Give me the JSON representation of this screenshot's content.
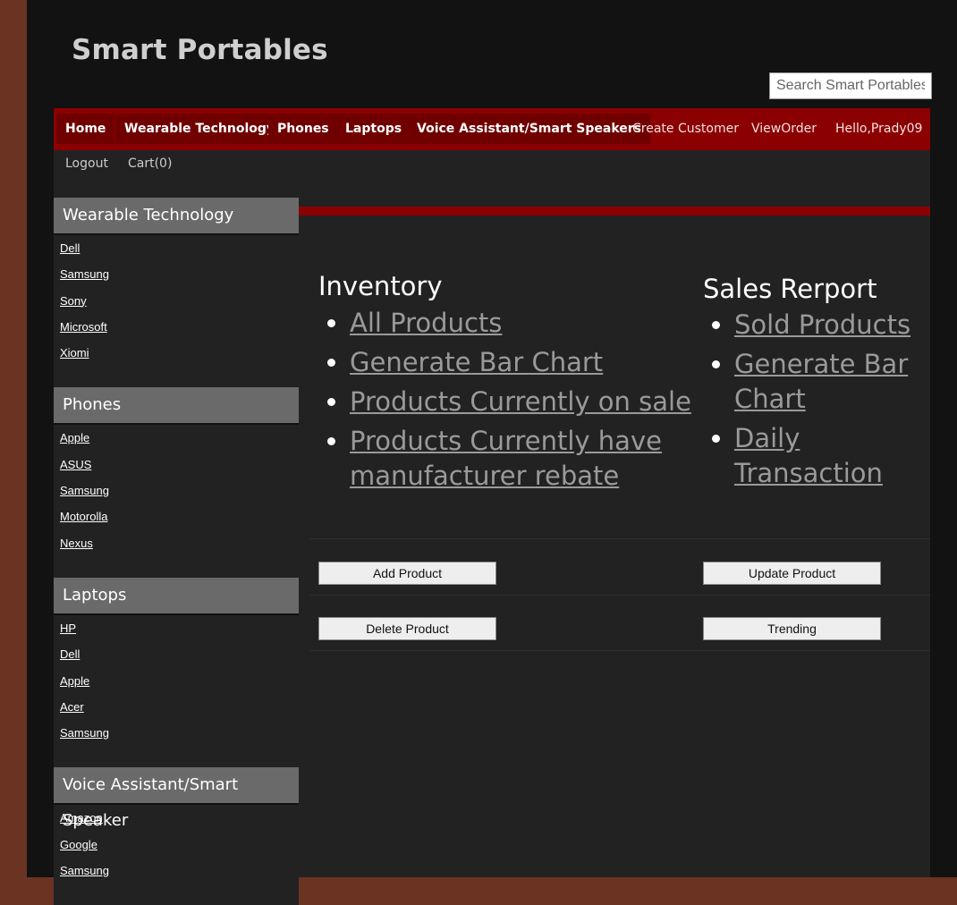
{
  "site": {
    "title": "Smart Portables"
  },
  "search": {
    "placeholder": "Search Smart Portables"
  },
  "nav": {
    "items": [
      "Home",
      "Wearable Technology",
      "Phones",
      "Laptops",
      "Voice Assistant/Smart Speakers"
    ],
    "links": [
      "Create Customer",
      "ViewOrder",
      "Hello,Prady09"
    ],
    "sub": [
      "Logout",
      "Cart(0)"
    ]
  },
  "sidebar": {
    "sections": [
      {
        "title": "Wearable Technology",
        "items": [
          "Dell",
          "Samsung",
          "Sony",
          "Microsoft",
          "Xiomi"
        ]
      },
      {
        "title": "Phones",
        "items": [
          "Apple",
          "ASUS",
          "Samsung",
          "Motorolla",
          "Nexus"
        ]
      },
      {
        "title": "Laptops",
        "items": [
          "HP",
          "Dell",
          "Apple",
          "Acer",
          "Samsung"
        ]
      },
      {
        "title": "Voice Assistant/Smart Speaker",
        "items": [
          "Amazon",
          "Google",
          "Samsung"
        ]
      }
    ]
  },
  "inventory": {
    "title": "Inventory",
    "links": [
      "All Products",
      "Generate Bar Chart",
      "Products Currently on sale",
      "Products Currently have manufacturer rebate"
    ]
  },
  "sales": {
    "title": "Sales Rerport",
    "links": [
      "Sold Products",
      "Generate Bar Chart",
      "Daily Transaction"
    ]
  },
  "buttons": {
    "add": "Add Product",
    "update": "Update Product",
    "delete": "Delete Product",
    "trending": "Trending"
  }
}
